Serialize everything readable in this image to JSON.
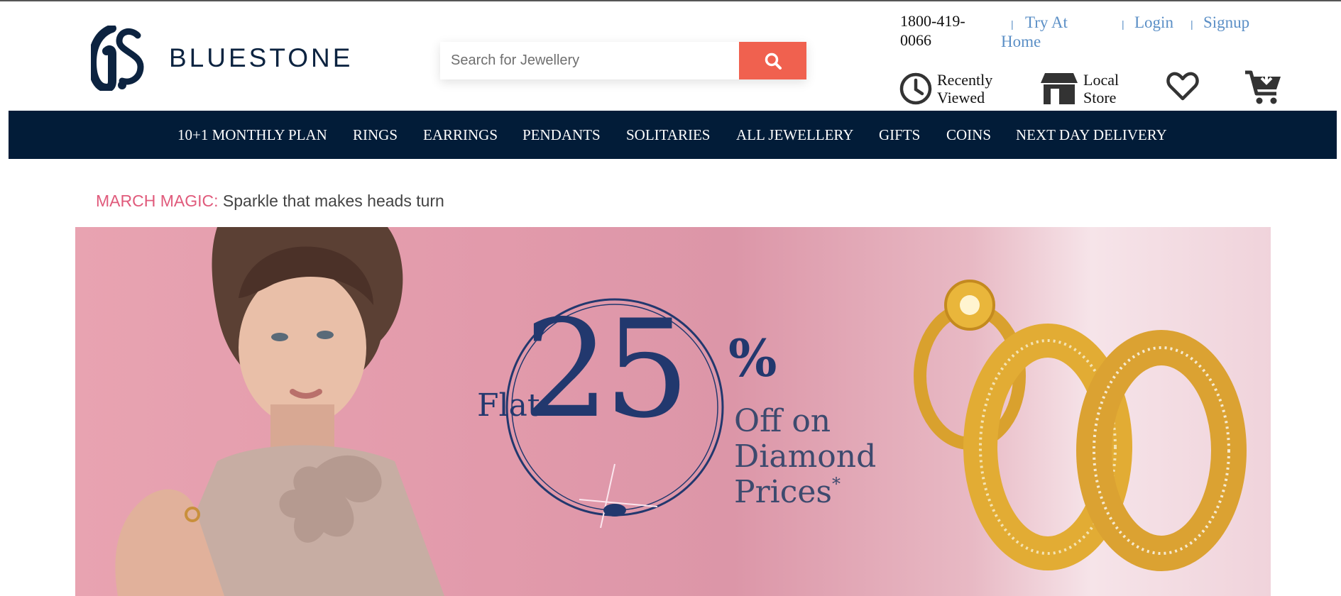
{
  "brand": {
    "name": "BLUESTONE",
    "logo_icon": "bluestone-bs-logo"
  },
  "search": {
    "placeholder": "Search for Jewellery",
    "icon": "search-icon"
  },
  "header": {
    "phone": "1800-419-0066",
    "try_at_home": "Try At Home",
    "login": "Login",
    "signup": "Signup",
    "separator": "|",
    "recently_viewed": "Recently Viewed",
    "local_store": "Local Store",
    "wishlist_icon": "heart-icon",
    "cart_icon": "cart-icon"
  },
  "nav": {
    "items": [
      "10+1 MONTHLY PLAN",
      "RINGS",
      "EARRINGS",
      "PENDANTS",
      "SOLITARIES",
      "ALL JEWELLERY",
      "GIFTS",
      "COINS",
      "NEXT DAY DELIVERY"
    ]
  },
  "promo": {
    "tag": "MARCH MAGIC:",
    "message": "Sparkle that makes heads turn"
  },
  "banner": {
    "flat": "Flat",
    "number": "25",
    "percent": "%",
    "line1": "Off on",
    "line2": "Diamond",
    "line3": "Prices",
    "asterisk": "*"
  },
  "colors": {
    "navy": "#021c38",
    "search_button": "#f0614f",
    "link": "#5b8fc6",
    "promo_tag": "#e05a7b",
    "banner_text": "#22386e"
  }
}
